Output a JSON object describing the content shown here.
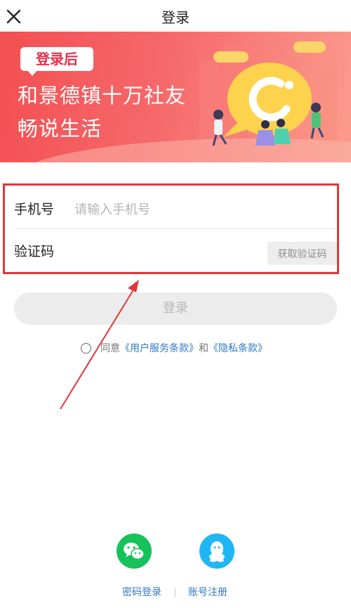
{
  "header": {
    "title": "登录"
  },
  "banner": {
    "tag": "登录后",
    "slogan_line1": "和景德镇十万社友",
    "slogan_line2": "畅说生活"
  },
  "form": {
    "phone_label": "手机号",
    "phone_placeholder": "请输入手机号",
    "phone_value": "",
    "code_label": "验证码",
    "code_value": "",
    "get_code_label": "获取验证码"
  },
  "login_button": {
    "label": "登录"
  },
  "agreement": {
    "prefix": "同意",
    "terms": "《用户服务条款》",
    "and": "和",
    "privacy": "《隐私条款》"
  },
  "social": {
    "wechat_icon": "wechat-icon",
    "qq_icon": "qq-icon"
  },
  "bottom_links": {
    "password_login": "密码登录",
    "register": "账号注册"
  },
  "colors": {
    "banner_red": "#f34f52",
    "highlight_box": "#e0373a",
    "link_blue": "#2f78c4",
    "wechat_green": "#16c25a",
    "qq_blue": "#20b6f5",
    "disabled_button": "#ececec"
  }
}
